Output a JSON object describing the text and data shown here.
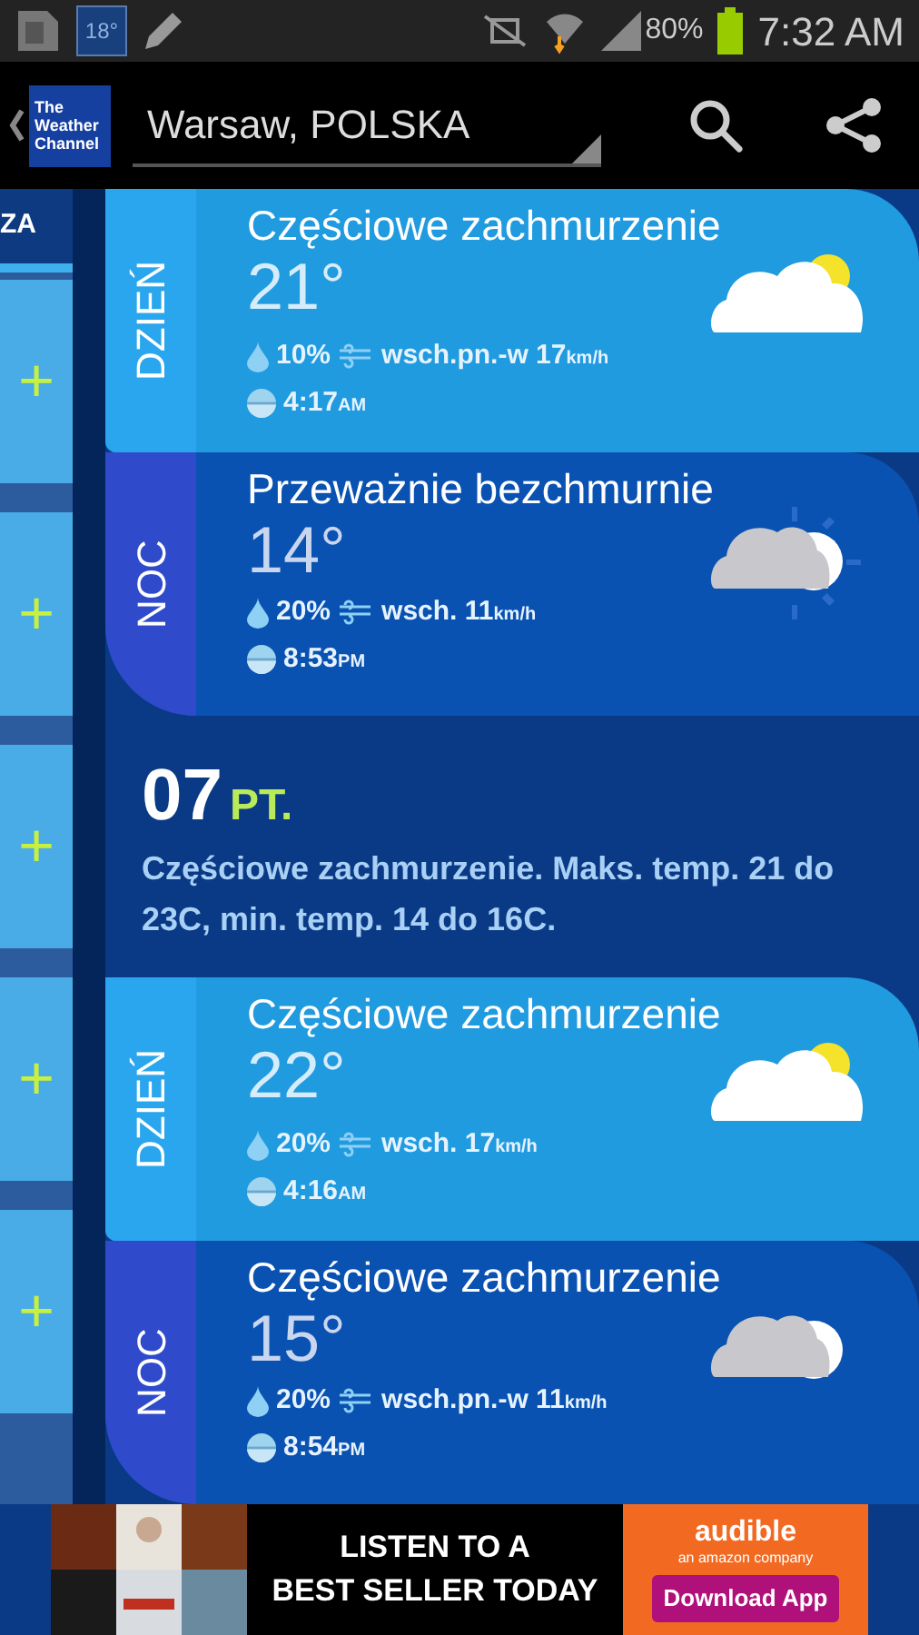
{
  "status_bar": {
    "temperature_badge": "18°",
    "battery": "80%",
    "time": "7:32 AM"
  },
  "header": {
    "logo": [
      "The",
      "Weather",
      "Channel"
    ],
    "location": "Warsaw, POLSKA"
  },
  "sidebar": {
    "header": "ZA",
    "items": [
      {
        "symbol": "+"
      },
      {
        "symbol": "+"
      },
      {
        "symbol": "+"
      },
      {
        "symbol": "+"
      },
      {
        "symbol": "+"
      }
    ]
  },
  "forecast": [
    {
      "kind": "day",
      "label": "DZIEŃ",
      "condition": "Częściowe zachmurzenie",
      "temperature": "21°",
      "precipitation": "10%",
      "wind": "wsch.pn.-w 17",
      "wind_unit": "km/h",
      "time": "4:17",
      "time_suffix": "AM"
    },
    {
      "kind": "night",
      "label": "NOC",
      "condition": "Przeważnie bezchmurnie",
      "temperature": "14°",
      "precipitation": "20%",
      "wind": "wsch. 11",
      "wind_unit": "km/h",
      "time": "8:53",
      "time_suffix": "PM"
    },
    {
      "kind": "summary",
      "date": "07",
      "weekday": "PT.",
      "text": "Częściowe zachmurzenie. Maks. temp. 21 do 23C, min. temp. 14 do 16C."
    },
    {
      "kind": "day",
      "label": "DZIEŃ",
      "condition": "Częściowe zachmurzenie",
      "temperature": "22°",
      "precipitation": "20%",
      "wind": "wsch. 17",
      "wind_unit": "km/h",
      "time": "4:16",
      "time_suffix": "AM"
    },
    {
      "kind": "night",
      "label": "NOC",
      "condition": "Częściowe zachmurzenie",
      "temperature": "15°",
      "precipitation": "20%",
      "wind": "wsch.pn.-w 11",
      "wind_unit": "km/h",
      "time": "8:54",
      "time_suffix": "PM"
    }
  ],
  "ad": {
    "headline": [
      "LISTEN TO A",
      "BEST SELLER TODAY"
    ],
    "brand": "audible",
    "tagline": "an amazon company",
    "button": "Download App"
  }
}
